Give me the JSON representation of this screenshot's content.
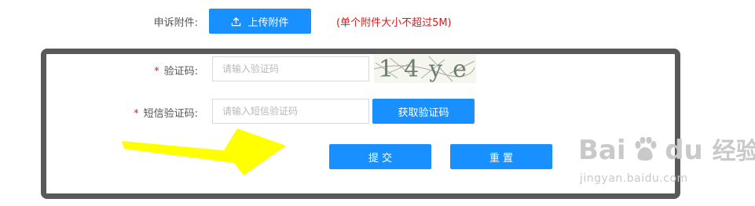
{
  "attachment": {
    "label": "申诉附件:",
    "upload_button": "上传附件",
    "size_note": "(单个附件大小不超过5M)"
  },
  "form": {
    "required_mark": "*",
    "captcha_label": "验证码:",
    "captcha_placeholder": "请输入验证码",
    "captcha_text": "14ye",
    "sms_label": "短信验证码:",
    "sms_placeholder": "请输入短信验证码",
    "get_code_button": "获取验证码",
    "submit_button": "提 交",
    "reset_button": "重 置"
  },
  "watermark": {
    "brand": "Bai",
    "brand2": "du",
    "suffix": "经验",
    "url": "jingyan.baidu.com"
  },
  "colors": {
    "primary": "#1890ff",
    "error": "#e01818",
    "frame": "#595959",
    "arrow": "#ffff00"
  }
}
